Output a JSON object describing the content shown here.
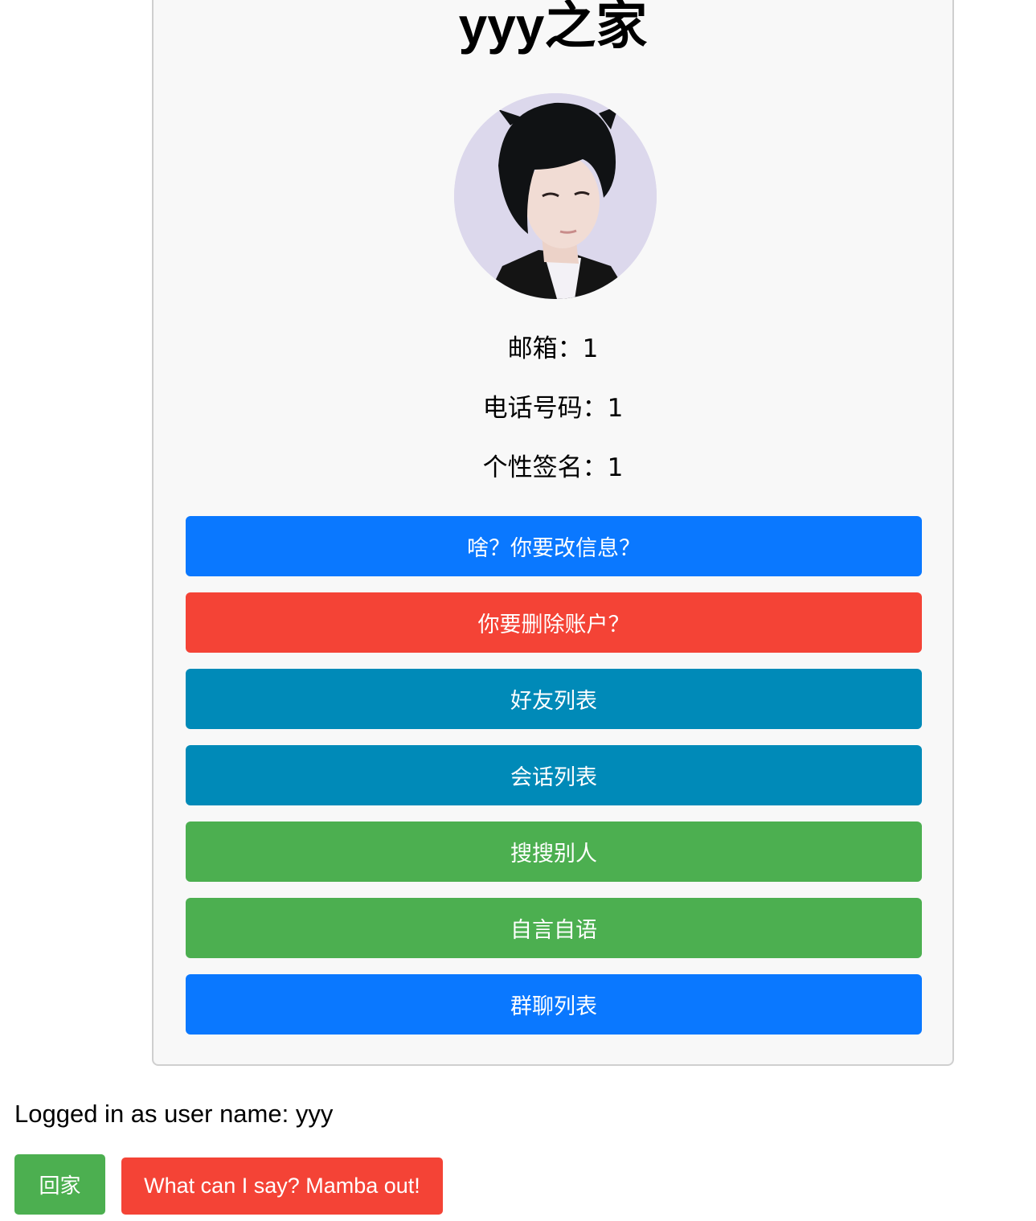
{
  "profile": {
    "title": "yyy之家",
    "email_line": "邮箱：1",
    "phone_line": "电话号码：1",
    "signature_line": "个性签名：1"
  },
  "actions": [
    {
      "label": "啥？你要改信息？",
      "color": "#0a78ff"
    },
    {
      "label": "你要删除账户？",
      "color": "#f44336"
    },
    {
      "label": "好友列表",
      "color": "#008ab8"
    },
    {
      "label": "会话列表",
      "color": "#008ab8"
    },
    {
      "label": "搜搜别人",
      "color": "#4caf50"
    },
    {
      "label": "自言自语",
      "color": "#4caf50"
    },
    {
      "label": "群聊列表",
      "color": "#0a78ff"
    }
  ],
  "footer": {
    "status": "Logged in as user name: yyy",
    "home_label": "回家",
    "logout_label": "What can I say? Mamba out!"
  }
}
